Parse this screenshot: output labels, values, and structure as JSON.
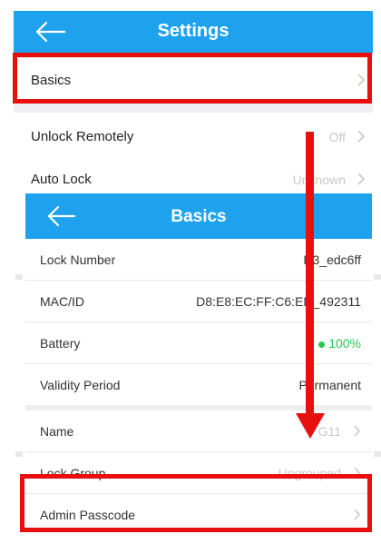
{
  "settings": {
    "title": "Settings",
    "rows": [
      {
        "label": "Basics",
        "value": ""
      },
      {
        "label": "Unlock Remotely",
        "value": "Off"
      },
      {
        "label": "Auto Lock",
        "value": "Unknown"
      }
    ]
  },
  "basics": {
    "title": "Basics",
    "rows": [
      {
        "label": "Lock Number",
        "value": "H3_edc6ff"
      },
      {
        "label": "MAC/ID",
        "value": "D8:E8:EC:FF:C6:ED_492311"
      },
      {
        "label": "Battery",
        "value": "100%"
      },
      {
        "label": "Validity Period",
        "value": "Permanent"
      }
    ],
    "rows2": [
      {
        "label": "Name",
        "value": "G11"
      },
      {
        "label": "Lock Group",
        "value": "Ungrouped"
      },
      {
        "label": "Admin Passcode",
        "value": ""
      }
    ]
  },
  "colors": {
    "header": "#1fa2ee",
    "highlight": "#e80f0f",
    "battery": "#28c850"
  },
  "icons": {
    "back": "arrow-left-icon",
    "chevron": "chevron-right-icon"
  }
}
